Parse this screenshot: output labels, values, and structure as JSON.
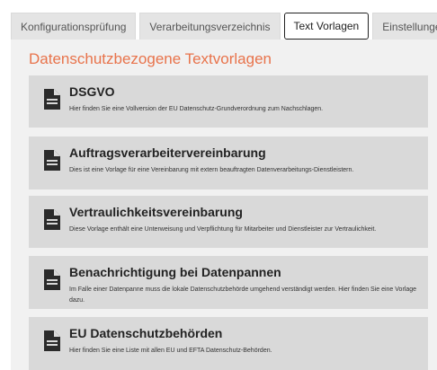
{
  "tabs": [
    {
      "label": "Konfigurationsprüfung"
    },
    {
      "label": "Verarbeitungsverzeichnis"
    },
    {
      "label": "Text Vorlagen"
    },
    {
      "label": "Einstellungen"
    }
  ],
  "active_tab": "Text Vorlagen",
  "page_title": "Datenschutzbezogene Textvorlagen",
  "colors": {
    "title_accent": "#e8734b",
    "card_background": "#d9d9d9",
    "panel_background": "#f1f1f1"
  },
  "cards": [
    {
      "icon": "document-icon",
      "title": "DSGVO",
      "description": "Hier finden Sie eine Vollversion der EU Datenschutz-Grundverordnung zum Nachschlagen."
    },
    {
      "icon": "document-icon",
      "title": "Auftragsverarbeitervereinbarung",
      "description": "Dies ist eine Vorlage für eine Vereinbarung mit extern beauftragten Datenverarbeitungs-Dienstleistern."
    },
    {
      "icon": "document-icon",
      "title": "Vertraulichkeitsvereinbarung",
      "description": "Diese Vorlage enthält eine Unterweisung und Verpflichtung für Mitarbeiter und Dienstleister zur Vertraulichkeit."
    },
    {
      "icon": "document-icon",
      "title": "Benachrichtigung bei Datenpannen",
      "description": "Im Falle einer Datenpanne muss die lokale Datenschutzbehörde umgehend verständigt werden. Hier finden Sie eine Vorlage dazu."
    },
    {
      "icon": "document-icon",
      "title": "EU Datenschutzbehörden",
      "description": "Hier finden Sie eine Liste mit allen EU und EFTA Datenschutz-Behörden."
    }
  ]
}
